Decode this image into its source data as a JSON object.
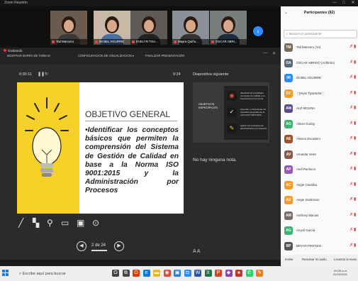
{
  "window": {
    "title": "Zoom Reunión",
    "controls": [
      "—",
      "□",
      "✕"
    ]
  },
  "video_strip": {
    "tiles": [
      {
        "name": "Tati Mancero",
        "shirt": "#3a3a3a",
        "bg": "#6b5a4e"
      },
      {
        "name": "00 BEL AGUIRRE",
        "shirt": "#4a6fa5",
        "bg": "#c8b8a6"
      },
      {
        "name": "EVELYN TOA...",
        "shirt": "#222222",
        "bg": "#5d5a57"
      },
      {
        "name": "Mayra Quiño...",
        "shirt": "#333333",
        "bg": "#8a8f98"
      },
      {
        "name": "OSCAR ABRI...",
        "shirt": "#1d2b3d",
        "bg": "#7a7d7e"
      }
    ],
    "next_icon": "chevron-right-icon"
  },
  "toolbar": {
    "recording": "Grabando",
    "show_taskbar": "MOSTRAR BARRA DE TAREAS",
    "display_settings": "CONFIGURACIÓN DE VISUALIZACIÓN ▾",
    "end_presentation": "FINALIZAR PRESENTACIÓN",
    "minimize": "—",
    "close": "✕"
  },
  "presenter": {
    "timer": "0:00:11",
    "slide_time": "9:24",
    "next_slide_label": "Diapositiva siguiente",
    "notes": "No hay ninguna nota.",
    "slide": {
      "title": "OBJETIVO GENERAL",
      "bullet": "•",
      "body": "Identificar los conceptos básicos que permiten la comprensión del Sistema de Gestión de Calidad en base a la Norma ISO 9001:2015 y la Administración por Procesos"
    },
    "next_slide": {
      "label": "OBJETIVOS ESPECÍFICOS",
      "items": [
        {
          "icon": "eye-icon",
          "text": "Identificar los principales conceptos de calidad y su importancia en la norma"
        },
        {
          "icon": "check-icon",
          "text": "Aprender y comprender los requisitos generales de la norma ISO 9001:2015"
        },
        {
          "icon": "pencil-icon",
          "text": "Aplicar los conceptos de administración por procesos"
        }
      ]
    },
    "slide_counter": "2 de 24",
    "text_size": "A  A"
  },
  "participants": {
    "title": "Participantes (82)",
    "search_placeholder": "Buscar un participante",
    "list": [
      {
        "name": "Tati Mancero (Yo)",
        "initials": "TM",
        "color": "#7a6a5a"
      },
      {
        "name": "OSCAR ABRIGO (Anfitrión)",
        "initials": "OA",
        "color": "#5a6a7a"
      },
      {
        "name": "00 BEL AGUIRRE",
        "initials": "00",
        "color": "#2d8cff"
      },
      {
        "name": "♡Deysi Tipantuña♡",
        "initials": "DT",
        "color": "#f39c2a"
      },
      {
        "name": "ALE MOLINA",
        "initials": "AM",
        "color": "#5b4a8a"
      },
      {
        "name": "Alison Godoy",
        "initials": "AG",
        "color": "#3cb371"
      },
      {
        "name": "Alisson Escudero",
        "initials": "AE",
        "color": "#a0522d"
      },
      {
        "name": "Amanda Velez",
        "initials": "AV",
        "color": "#8b5a4a"
      },
      {
        "name": "Anel Pacheco",
        "initials": "AP",
        "color": "#9b59b6"
      },
      {
        "name": "Angie Cevallos",
        "initials": "AC",
        "color": "#f39c2a"
      },
      {
        "name": "Angie Zambrano",
        "initials": "AZ",
        "color": "#f39c2a"
      },
      {
        "name": "Anthony Macias",
        "initials": "AM",
        "color": "#7a6a6a"
      },
      {
        "name": "Anyeli García",
        "initials": "AG",
        "color": "#3cb371"
      },
      {
        "name": "BRYAN PINTADO",
        "initials": "BP",
        "color": "#555555"
      }
    ],
    "mic_icon": "🎤",
    "video_icon": "▭",
    "invite": "Invitar",
    "unmute_me": "Reactivar mi audio",
    "raise_hand": "Levantar la mano"
  },
  "taskbar": {
    "search": "Escribe aquí para buscar",
    "apps": [
      {
        "icon": "cortana-icon",
        "glyph": "O",
        "color": "#444444"
      },
      {
        "icon": "task-view-icon",
        "glyph": "⧉",
        "color": "#444444"
      },
      {
        "icon": "office-icon",
        "glyph": "O",
        "color": "#d83b01"
      },
      {
        "icon": "edge-icon",
        "glyph": "e",
        "color": "#0f7bd4"
      },
      {
        "icon": "folder-icon",
        "glyph": "▬",
        "color": "#f2b71e"
      },
      {
        "icon": "chrome-icon",
        "glyph": "◉",
        "color": "#dd4b39"
      },
      {
        "icon": "store-icon",
        "glyph": "▣",
        "color": "#2d7dd2"
      },
      {
        "icon": "zoom-icon",
        "glyph": "◘",
        "color": "#2d8cff"
      },
      {
        "icon": "word-icon",
        "glyph": "W",
        "color": "#2b579a"
      },
      {
        "icon": "excel-icon",
        "glyph": "X",
        "color": "#217346"
      },
      {
        "icon": "powerpoint-icon",
        "glyph": "P",
        "color": "#d24726"
      },
      {
        "icon": "app-icon",
        "glyph": "◆",
        "color": "#8e44ad"
      },
      {
        "icon": "camera-icon",
        "glyph": "●",
        "color": "#c0392b"
      },
      {
        "icon": "whatsapp-icon",
        "glyph": "✆",
        "color": "#25d366"
      },
      {
        "icon": "paint-icon",
        "glyph": "✎",
        "color": "#e67e22"
      }
    ],
    "time": "09:26 a.m.",
    "date": "01/02/2021"
  }
}
